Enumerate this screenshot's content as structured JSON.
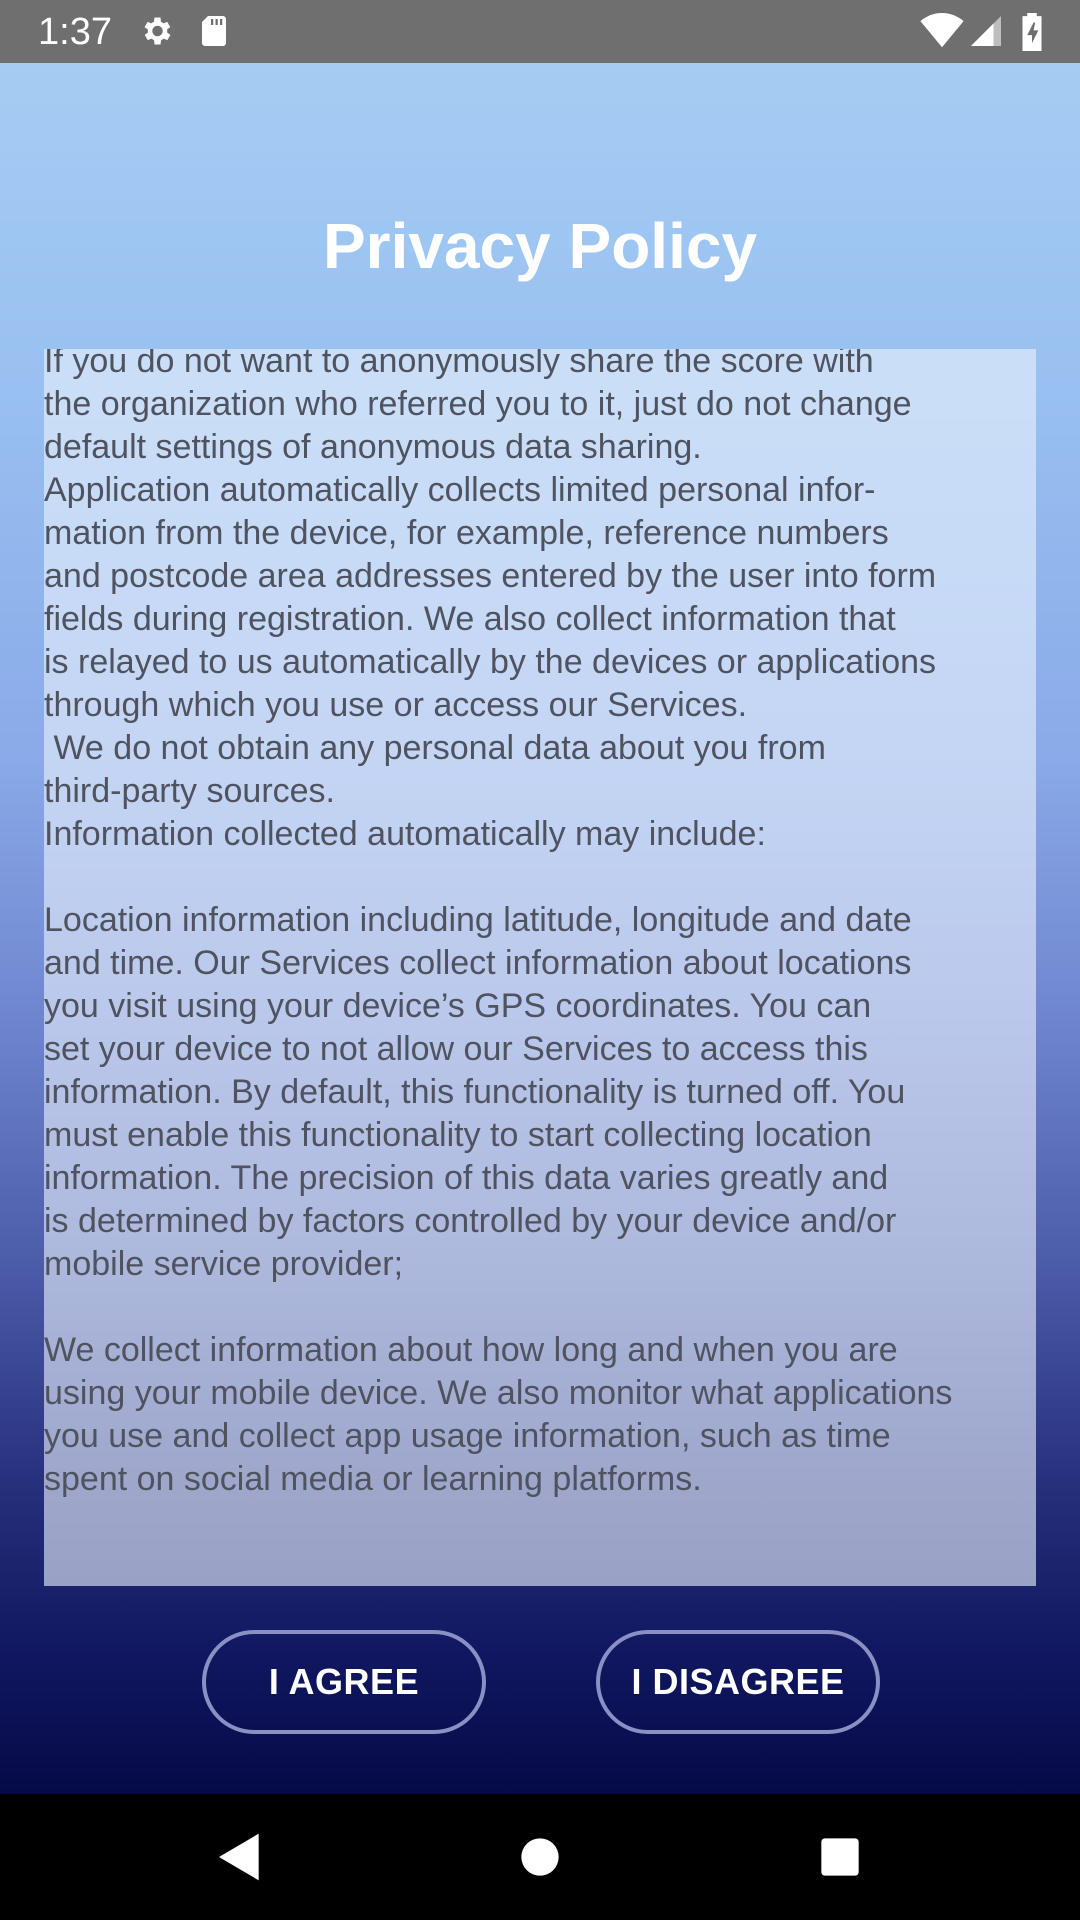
{
  "status_bar": {
    "time": "1:37",
    "icons": [
      "settings-icon",
      "sd-card-icon",
      "wifi-icon",
      "cellular-icon",
      "battery-charging-icon"
    ]
  },
  "screen": {
    "title": "Privacy Policy",
    "policy_text": "If you do not want to anonymously share the score with\nthe organization who referred you to it, just do not change\ndefault settings of anonymous data sharing.\nApplication automatically collects limited personal infor-\nmation from the device, for example, reference numbers\nand postcode area addresses entered by the user into form\nfields during registration. We also collect information that\nis relayed to us automatically by the devices or applications\nthrough which you use or access our Services.\n We do not obtain any personal data about you from\nthird-party sources.\nInformation collected automatically may include:\n\nLocation information including latitude, longitude and date\nand time. Our Services collect information about locations\nyou visit using your device’s GPS coordinates. You can\nset your device to not allow our Services to access this\ninformation. By default, this functionality is turned off. You\nmust enable this functionality to start collecting location\ninformation. The precision of this data varies greatly and\nis determined by factors controlled by your device and/or\nmobile service provider;\n\nWe collect information about how long and when you are\nusing your mobile device. We also monitor what applications\nyou use and collect app usage information, such as time\nspent on social media or learning platforms.",
    "agree_label": "I AGREE",
    "disagree_label": "I DISAGREE"
  },
  "nav_bar": {
    "icons": [
      "back-icon",
      "home-icon",
      "recents-icon"
    ]
  }
}
